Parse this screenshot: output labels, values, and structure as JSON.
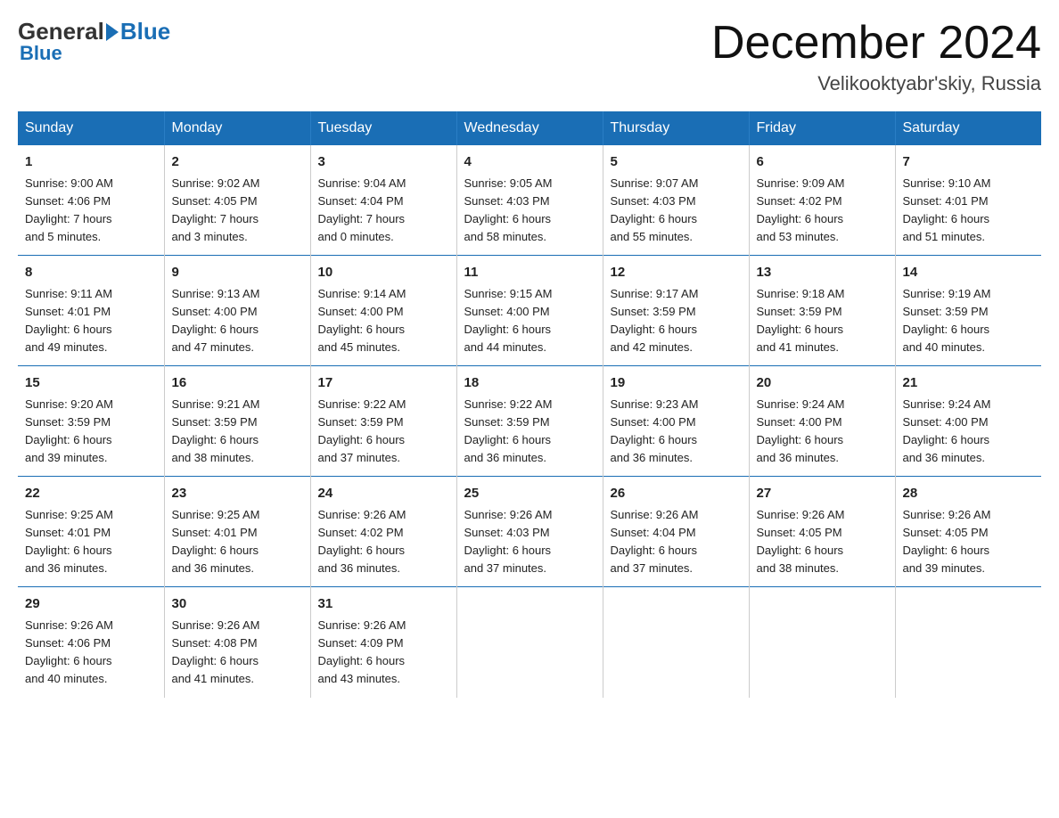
{
  "header": {
    "logo_general": "General",
    "logo_blue": "Blue",
    "month_title": "December 2024",
    "location": "Velikooktyabr'skiy, Russia"
  },
  "days_of_week": [
    "Sunday",
    "Monday",
    "Tuesday",
    "Wednesday",
    "Thursday",
    "Friday",
    "Saturday"
  ],
  "weeks": [
    [
      {
        "num": "1",
        "sunrise": "9:00 AM",
        "sunset": "4:06 PM",
        "daylight": "7 hours and 5 minutes."
      },
      {
        "num": "2",
        "sunrise": "9:02 AM",
        "sunset": "4:05 PM",
        "daylight": "7 hours and 3 minutes."
      },
      {
        "num": "3",
        "sunrise": "9:04 AM",
        "sunset": "4:04 PM",
        "daylight": "7 hours and 0 minutes."
      },
      {
        "num": "4",
        "sunrise": "9:05 AM",
        "sunset": "4:03 PM",
        "daylight": "6 hours and 58 minutes."
      },
      {
        "num": "5",
        "sunrise": "9:07 AM",
        "sunset": "4:03 PM",
        "daylight": "6 hours and 55 minutes."
      },
      {
        "num": "6",
        "sunrise": "9:09 AM",
        "sunset": "4:02 PM",
        "daylight": "6 hours and 53 minutes."
      },
      {
        "num": "7",
        "sunrise": "9:10 AM",
        "sunset": "4:01 PM",
        "daylight": "6 hours and 51 minutes."
      }
    ],
    [
      {
        "num": "8",
        "sunrise": "9:11 AM",
        "sunset": "4:01 PM",
        "daylight": "6 hours and 49 minutes."
      },
      {
        "num": "9",
        "sunrise": "9:13 AM",
        "sunset": "4:00 PM",
        "daylight": "6 hours and 47 minutes."
      },
      {
        "num": "10",
        "sunrise": "9:14 AM",
        "sunset": "4:00 PM",
        "daylight": "6 hours and 45 minutes."
      },
      {
        "num": "11",
        "sunrise": "9:15 AM",
        "sunset": "4:00 PM",
        "daylight": "6 hours and 44 minutes."
      },
      {
        "num": "12",
        "sunrise": "9:17 AM",
        "sunset": "3:59 PM",
        "daylight": "6 hours and 42 minutes."
      },
      {
        "num": "13",
        "sunrise": "9:18 AM",
        "sunset": "3:59 PM",
        "daylight": "6 hours and 41 minutes."
      },
      {
        "num": "14",
        "sunrise": "9:19 AM",
        "sunset": "3:59 PM",
        "daylight": "6 hours and 40 minutes."
      }
    ],
    [
      {
        "num": "15",
        "sunrise": "9:20 AM",
        "sunset": "3:59 PM",
        "daylight": "6 hours and 39 minutes."
      },
      {
        "num": "16",
        "sunrise": "9:21 AM",
        "sunset": "3:59 PM",
        "daylight": "6 hours and 38 minutes."
      },
      {
        "num": "17",
        "sunrise": "9:22 AM",
        "sunset": "3:59 PM",
        "daylight": "6 hours and 37 minutes."
      },
      {
        "num": "18",
        "sunrise": "9:22 AM",
        "sunset": "3:59 PM",
        "daylight": "6 hours and 36 minutes."
      },
      {
        "num": "19",
        "sunrise": "9:23 AM",
        "sunset": "4:00 PM",
        "daylight": "6 hours and 36 minutes."
      },
      {
        "num": "20",
        "sunrise": "9:24 AM",
        "sunset": "4:00 PM",
        "daylight": "6 hours and 36 minutes."
      },
      {
        "num": "21",
        "sunrise": "9:24 AM",
        "sunset": "4:00 PM",
        "daylight": "6 hours and 36 minutes."
      }
    ],
    [
      {
        "num": "22",
        "sunrise": "9:25 AM",
        "sunset": "4:01 PM",
        "daylight": "6 hours and 36 minutes."
      },
      {
        "num": "23",
        "sunrise": "9:25 AM",
        "sunset": "4:01 PM",
        "daylight": "6 hours and 36 minutes."
      },
      {
        "num": "24",
        "sunrise": "9:26 AM",
        "sunset": "4:02 PM",
        "daylight": "6 hours and 36 minutes."
      },
      {
        "num": "25",
        "sunrise": "9:26 AM",
        "sunset": "4:03 PM",
        "daylight": "6 hours and 37 minutes."
      },
      {
        "num": "26",
        "sunrise": "9:26 AM",
        "sunset": "4:04 PM",
        "daylight": "6 hours and 37 minutes."
      },
      {
        "num": "27",
        "sunrise": "9:26 AM",
        "sunset": "4:05 PM",
        "daylight": "6 hours and 38 minutes."
      },
      {
        "num": "28",
        "sunrise": "9:26 AM",
        "sunset": "4:05 PM",
        "daylight": "6 hours and 39 minutes."
      }
    ],
    [
      {
        "num": "29",
        "sunrise": "9:26 AM",
        "sunset": "4:06 PM",
        "daylight": "6 hours and 40 minutes."
      },
      {
        "num": "30",
        "sunrise": "9:26 AM",
        "sunset": "4:08 PM",
        "daylight": "6 hours and 41 minutes."
      },
      {
        "num": "31",
        "sunrise": "9:26 AM",
        "sunset": "4:09 PM",
        "daylight": "6 hours and 43 minutes."
      },
      null,
      null,
      null,
      null
    ]
  ]
}
